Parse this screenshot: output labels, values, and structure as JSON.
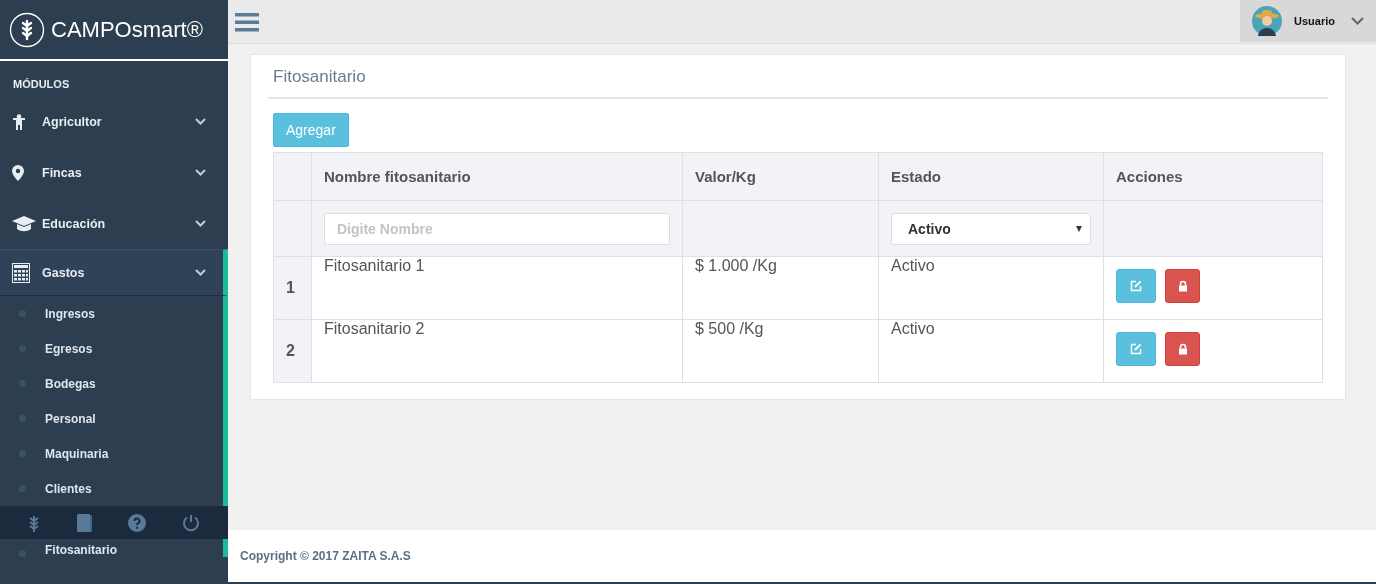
{
  "brand": "CAMPOsmart®",
  "sidebar": {
    "section": "MÓDULOS",
    "items": [
      {
        "label": "Agricultor",
        "kind": "person",
        "expanded": false
      },
      {
        "label": "Fincas",
        "kind": "pin",
        "expanded": false
      },
      {
        "label": "Educación",
        "kind": "cap",
        "expanded": false
      },
      {
        "label": "Gastos",
        "kind": "calc",
        "expanded": true,
        "children": [
          {
            "label": "Ingresos"
          },
          {
            "label": "Egresos"
          },
          {
            "label": "Bodegas"
          },
          {
            "label": "Personal"
          },
          {
            "label": "Maquinaria"
          },
          {
            "label": "Clientes"
          },
          {
            "label": "Fitosanitario"
          }
        ]
      }
    ]
  },
  "user": {
    "name": "Usuario"
  },
  "panel": {
    "title": "Fitosanitario",
    "add_button": "Agregar",
    "table": {
      "columns": [
        "Nombre fitosanitario",
        "Valor/Kg",
        "Estado",
        "Acciones"
      ],
      "filter": {
        "placeholder": "Digite Nombre",
        "estado": "Activo"
      },
      "rows": [
        {
          "index": "1",
          "name": "Fitosanitario 1",
          "value": "$ 1.000 /Kg",
          "estado": "Activo"
        },
        {
          "index": "2",
          "name": "Fitosanitario 2",
          "value": "$ 500 /Kg",
          "estado": "Activo"
        }
      ]
    }
  },
  "footer": "Copyright © 2017 ZAITA S.A.S"
}
